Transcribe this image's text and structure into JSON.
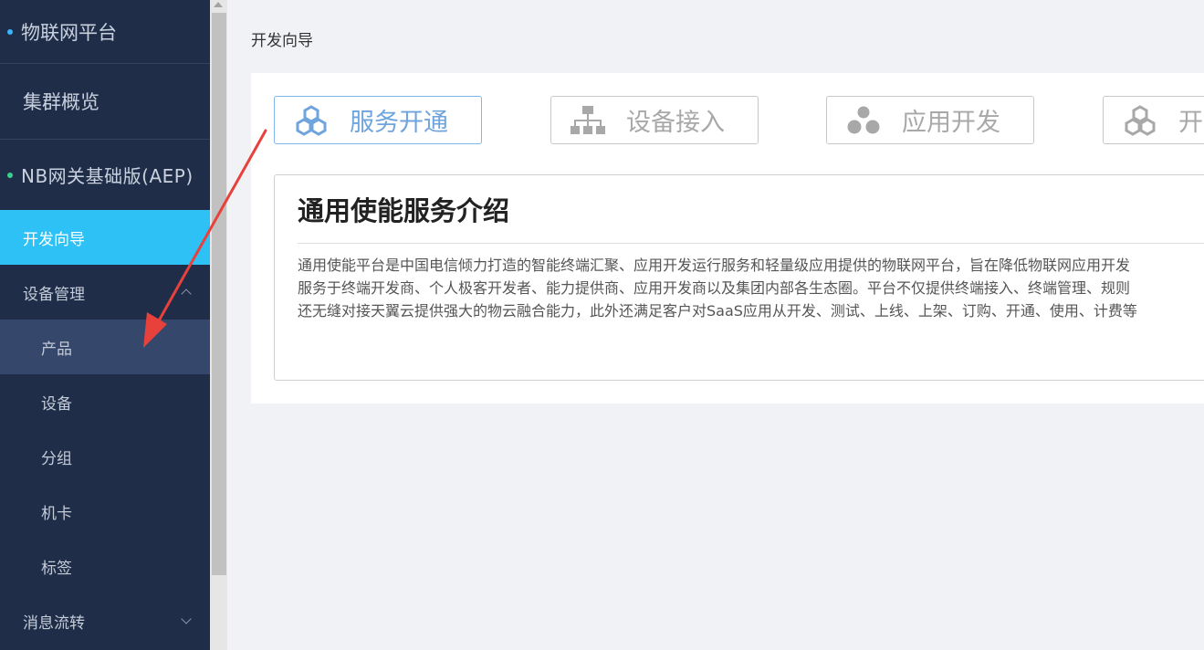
{
  "sidebar": {
    "platform": "物联网平台",
    "cluster": "集群概览",
    "product": "NB网关基础版(AEP)",
    "items": [
      {
        "label": "开发向导"
      },
      {
        "label": "设备管理"
      },
      {
        "label": "产品"
      },
      {
        "label": "设备"
      },
      {
        "label": "分组"
      },
      {
        "label": "机卡"
      },
      {
        "label": "标签"
      },
      {
        "label": "消息流转"
      }
    ]
  },
  "main": {
    "title": "开发向导",
    "steps": [
      {
        "label": "服务开通",
        "icon": "hexagon-cluster-icon"
      },
      {
        "label": "设备接入",
        "icon": "network-tree-icon"
      },
      {
        "label": "应用开发",
        "icon": "circles-cluster-icon"
      },
      {
        "label": "开",
        "icon": "hexagon-cluster-icon"
      }
    ],
    "info": {
      "title": "通用使能服务介绍",
      "lines": [
        "通用使能平台是中国电信倾力打造的智能终端汇聚、应用开发运行服务和轻量级应用提供的物联网平台，旨在降低物联网应用开发",
        "服务于终端开发商、个人极客开发者、能力提供商、应用开发商以及集团内部各生态圈。平台不仅提供终端接入、终端管理、规则",
        "还无缝对接天翼云提供强大的物云融合能力，此外还满足客户对SaaS应用从开发、测试、上线、上架、订购、开通、使用、计费等"
      ]
    }
  },
  "colors": {
    "sidebar_bg": "#1f2d48",
    "active_item": "#2dc1f5",
    "selected_sub": "#35476b",
    "accent_blue": "#6fa4dc",
    "annotation_red": "#e8413c"
  }
}
